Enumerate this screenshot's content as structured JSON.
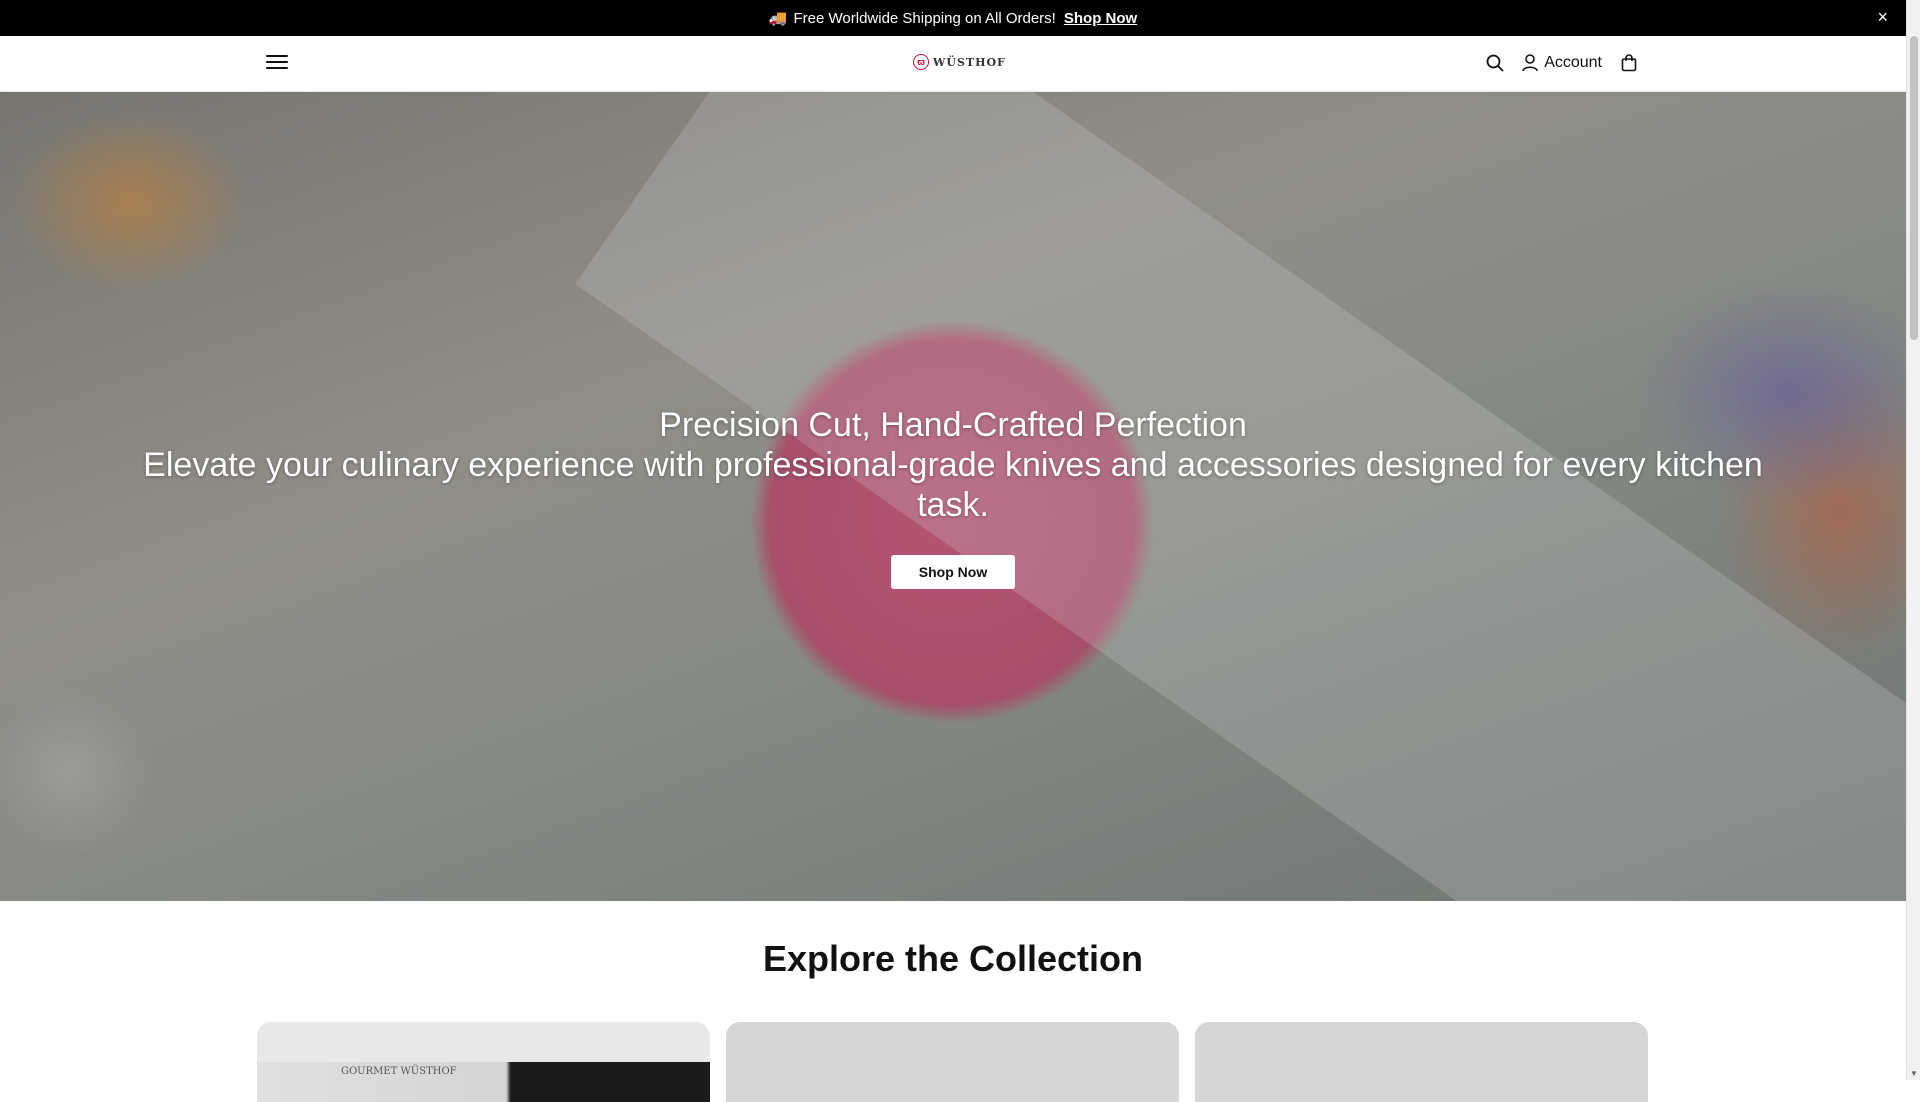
{
  "announcement": {
    "truck_icon": "🚚",
    "text": "Free Worldwide Shipping on All Orders!",
    "link": "Shop Now",
    "close": "×"
  },
  "header": {
    "logo_text": "WÜSTHOF",
    "account_label": "Account"
  },
  "hero": {
    "title": "Precision Cut, Hand-Crafted Perfection",
    "subtitle": "Elevate your culinary experience with professional-grade knives and accessories designed for every kitchen task.",
    "button": "Shop Now"
  },
  "collection": {
    "title": "Explore the Collection",
    "card_brand": "GOURMET WÜSTHOF"
  },
  "colors": {
    "announcement_bg": "#000000",
    "brand_red": "#c8102e",
    "hero_button_bg": "#ffffff"
  },
  "icons": [
    "hamburger-menu-icon",
    "search-icon",
    "user-icon",
    "shopping-bag-icon",
    "truck-icon",
    "close-icon"
  ]
}
